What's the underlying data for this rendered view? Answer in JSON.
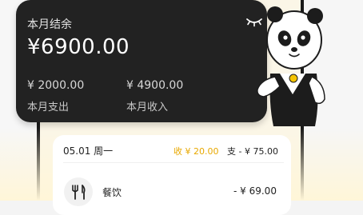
{
  "balance": {
    "title": "本月结余",
    "amount": "¥6900.00",
    "expense_value": "¥ 2000.00",
    "expense_label": "本月支出",
    "income_value": "¥ 4900.00",
    "income_label": "本月收入"
  },
  "day": {
    "date": "05.01 周一",
    "income": "收 ¥ 20.00",
    "expense": "支 - ¥ 75.00"
  },
  "transactions": [
    {
      "category": "餐饮",
      "amount": "- ¥ 69.00",
      "icon": "fork-knife-icon"
    }
  ],
  "colors": {
    "card_dark": "#222222",
    "income_accent": "#e8a800",
    "background_warm": "#fbf6e7"
  },
  "icons": {
    "eye": "closed-eye-icon",
    "mascot": "panda-mascot"
  }
}
